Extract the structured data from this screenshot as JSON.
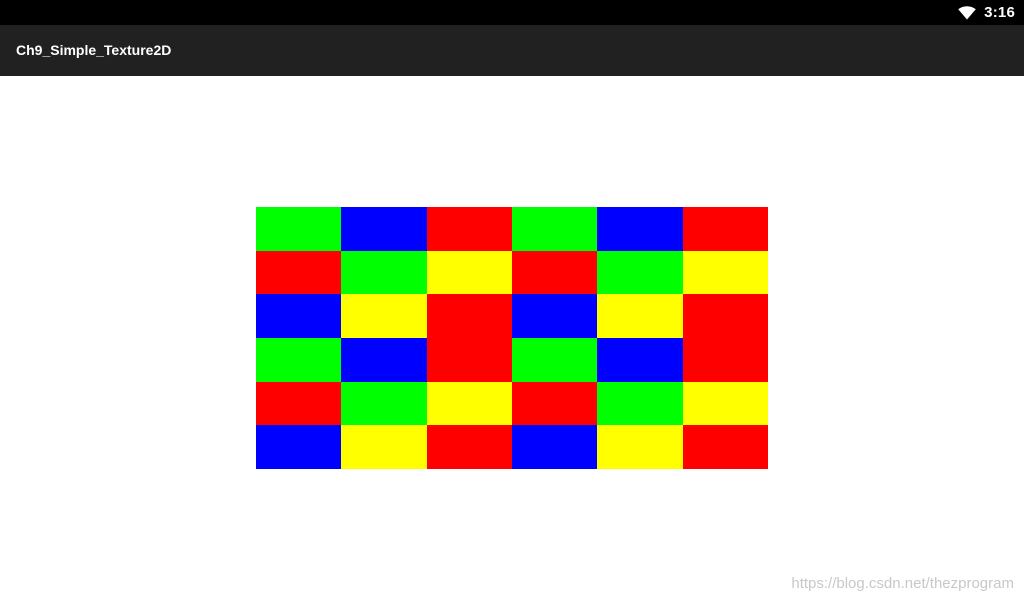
{
  "status_bar": {
    "time": "3:16",
    "icons": [
      "wifi-icon"
    ]
  },
  "action_bar": {
    "title": "Ch9_Simple_Texture2D"
  },
  "texture": {
    "colors": {
      "green": "#00ff00",
      "blue": "#0000ff",
      "red": "#ff0000",
      "yellow": "#ffff00"
    },
    "grid": [
      [
        "green",
        "blue",
        "red",
        "green",
        "blue",
        "red"
      ],
      [
        "red",
        "green",
        "yellow",
        "red",
        "green",
        "yellow"
      ],
      [
        "blue",
        "yellow",
        "red",
        "blue",
        "yellow",
        "red"
      ],
      [
        "green",
        "blue",
        "red",
        "green",
        "blue",
        "red"
      ],
      [
        "red",
        "green",
        "yellow",
        "red",
        "green",
        "yellow"
      ],
      [
        "blue",
        "yellow",
        "red",
        "blue",
        "yellow",
        "red"
      ]
    ]
  },
  "watermark": "https://blog.csdn.net/thezprogram"
}
